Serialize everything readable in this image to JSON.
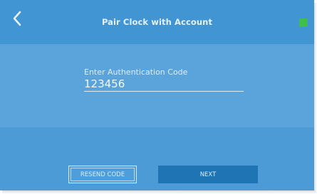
{
  "header": {
    "title": "Pair Clock with Account",
    "back_icon": "chevron-left-icon",
    "status_icon": "status-indicator-icon",
    "status_color": "#3fbe4c"
  },
  "form": {
    "code_label": "Enter Authentication Code",
    "code_value": "123456"
  },
  "actions": {
    "resend_label": "RESEND CODE",
    "next_label": "NEXT"
  },
  "colors": {
    "header_bg": "#4195d3",
    "content_bg": "#5ba4db",
    "footer_bg": "#4c9bd7",
    "next_button_bg": "#1f75b4"
  }
}
